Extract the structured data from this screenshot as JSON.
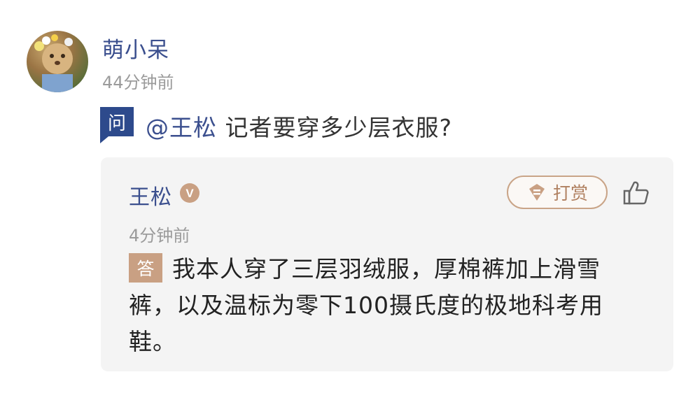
{
  "post": {
    "username": "萌小呆",
    "time": "44分钟前",
    "ask_label": "问",
    "mention": "@王松",
    "question": "记者要穿多少层衣服?"
  },
  "answer": {
    "author": "王松",
    "verified_label": "V",
    "time": "4分钟前",
    "reward_label": "打赏",
    "answer_label": "答",
    "text": "我本人穿了三层羽绒服，厚棉裤加上滑雪裤，以及温标为零下100摄氏度的极地科考用鞋。"
  },
  "colors": {
    "name_blue": "#3b4f8e",
    "ask_badge": "#2d4a8c",
    "answer_badge": "#c9a083",
    "reward_border": "#c9a487",
    "card_bg": "#f4f4f4"
  },
  "icons": {
    "verified": "verified-v-icon",
    "reward": "reward-coin-icon",
    "like": "thumbs-up-icon"
  }
}
